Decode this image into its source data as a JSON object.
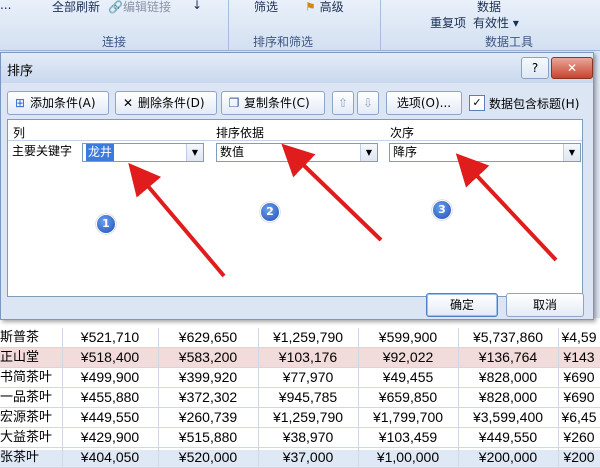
{
  "ribbon": {
    "items": [
      "全部刷新",
      "编辑链接",
      "高级",
      "重复项",
      "有效性",
      "数据"
    ],
    "groups": [
      "连接",
      "排序和筛选",
      "数据工具"
    ]
  },
  "dialog": {
    "title": "排序",
    "help": "?",
    "close": "✕",
    "buttons": {
      "add": "添加条件(A)",
      "delete": "删除条件(D)",
      "copy": "复制条件(C)",
      "options": "选项(O)...",
      "ok": "确定",
      "cancel": "取消"
    },
    "has_header_label": "数据包含标题(H)",
    "has_header_checked": true,
    "columns": {
      "col": "列",
      "sort_on": "排序依据",
      "order": "次序"
    },
    "row": {
      "label": "主要关键字",
      "column": "龙井",
      "sort_on": "数值",
      "order": "降序"
    },
    "badges": [
      "1",
      "2",
      "3"
    ]
  },
  "sheet": {
    "rows": [
      {
        "name": "斯普茶",
        "values": [
          "¥521,710",
          "¥629,650",
          "¥1,259,790",
          "¥599,900",
          "¥5,737,860",
          "¥4,59"
        ]
      },
      {
        "name": "正山堂",
        "values": [
          "¥518,400",
          "¥583,200",
          "¥103,176",
          "¥92,022",
          "¥136,764",
          "¥143"
        ]
      },
      {
        "name": "书简茶叶",
        "values": [
          "¥499,900",
          "¥399,920",
          "¥77,970",
          "¥49,455",
          "¥828,000",
          "¥690"
        ]
      },
      {
        "name": "一品茶叶",
        "values": [
          "¥455,880",
          "¥372,302",
          "¥945,785",
          "¥659,850",
          "¥828,000",
          "¥690"
        ]
      },
      {
        "name": "宏源茶叶",
        "values": [
          "¥449,550",
          "¥260,739",
          "¥1,259,790",
          "¥1,799,700",
          "¥3,599,400",
          "¥6,45"
        ]
      },
      {
        "name": "大益茶叶",
        "values": [
          "¥429,900",
          "¥515,880",
          "¥38,970",
          "¥103,459",
          "¥449,550",
          "¥260"
        ]
      },
      {
        "name": "张茶叶",
        "values": [
          "¥404,050",
          "¥520,000",
          "¥37,000",
          "¥1,00,000",
          "¥200,000",
          "¥200"
        ]
      }
    ]
  }
}
